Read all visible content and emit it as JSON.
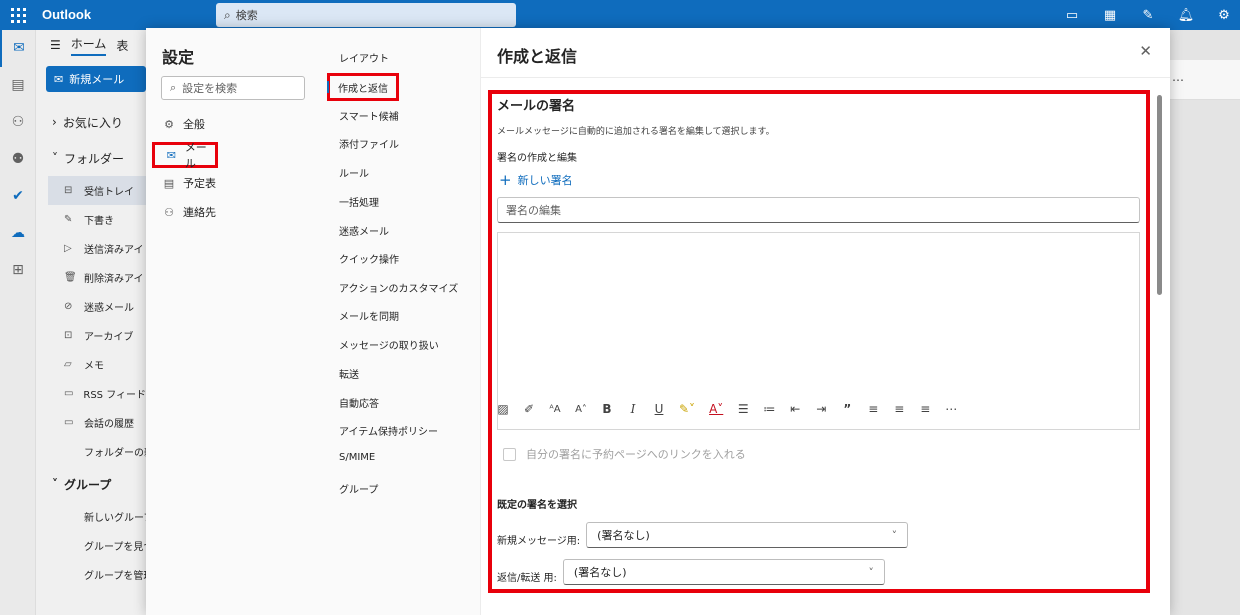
{
  "app": {
    "name": "Outlook",
    "search_placeholder": "検索"
  },
  "ribbon": {
    "tab_home": "ホーム",
    "tab_next": "表",
    "new_mail": "新規メール"
  },
  "folders": {
    "favorites": "お気に入り",
    "folders_header": "フォルダー",
    "items": [
      "受信トレイ",
      "下書き",
      "送信済みアイ",
      "削除済みアイ",
      "迷惑メール",
      "アーカイブ",
      "メモ",
      "RSS フィード",
      "会話の履歴"
    ],
    "new_folder": "フォルダーの新",
    "groups_header": "グループ",
    "group_items": [
      "新しいグループ",
      "グループを見つ",
      "グループを管理"
    ]
  },
  "settings": {
    "title": "設定",
    "search_placeholder": "設定を検索",
    "categories": [
      "全般",
      "メール",
      "予定表",
      "連絡先"
    ],
    "subcategories": [
      "レイアウト",
      "作成と返信",
      "スマート候補",
      "添付ファイル",
      "ルール",
      "一括処理",
      "迷惑メール",
      "クイック操作",
      "アクションのカスタマイズ",
      "メールを同期",
      "メッセージの取り扱い",
      "転送",
      "自動応答",
      "アイテム保持ポリシー",
      "S/MIME",
      "グループ"
    ]
  },
  "panel": {
    "title": "作成と返信",
    "section_title": "メールの署名",
    "description": "メールメッセージに自動的に追加される署名を編集して選択します。",
    "create_edit_label": "署名の作成と編集",
    "new_signature": "新しい署名",
    "signature_name_placeholder": "署名の編集",
    "booking_link_label": "自分の署名に予約ページへのリンクを入れる",
    "default_header": "既定の署名を選択",
    "new_message_label": "新規メッセージ用:",
    "new_message_value": "(署名なし)",
    "reply_label": "返信/転送 用:",
    "reply_value": "(署名なし)"
  },
  "colors": {
    "brand": "#0f6cbd",
    "highlight": "#e8000b"
  }
}
